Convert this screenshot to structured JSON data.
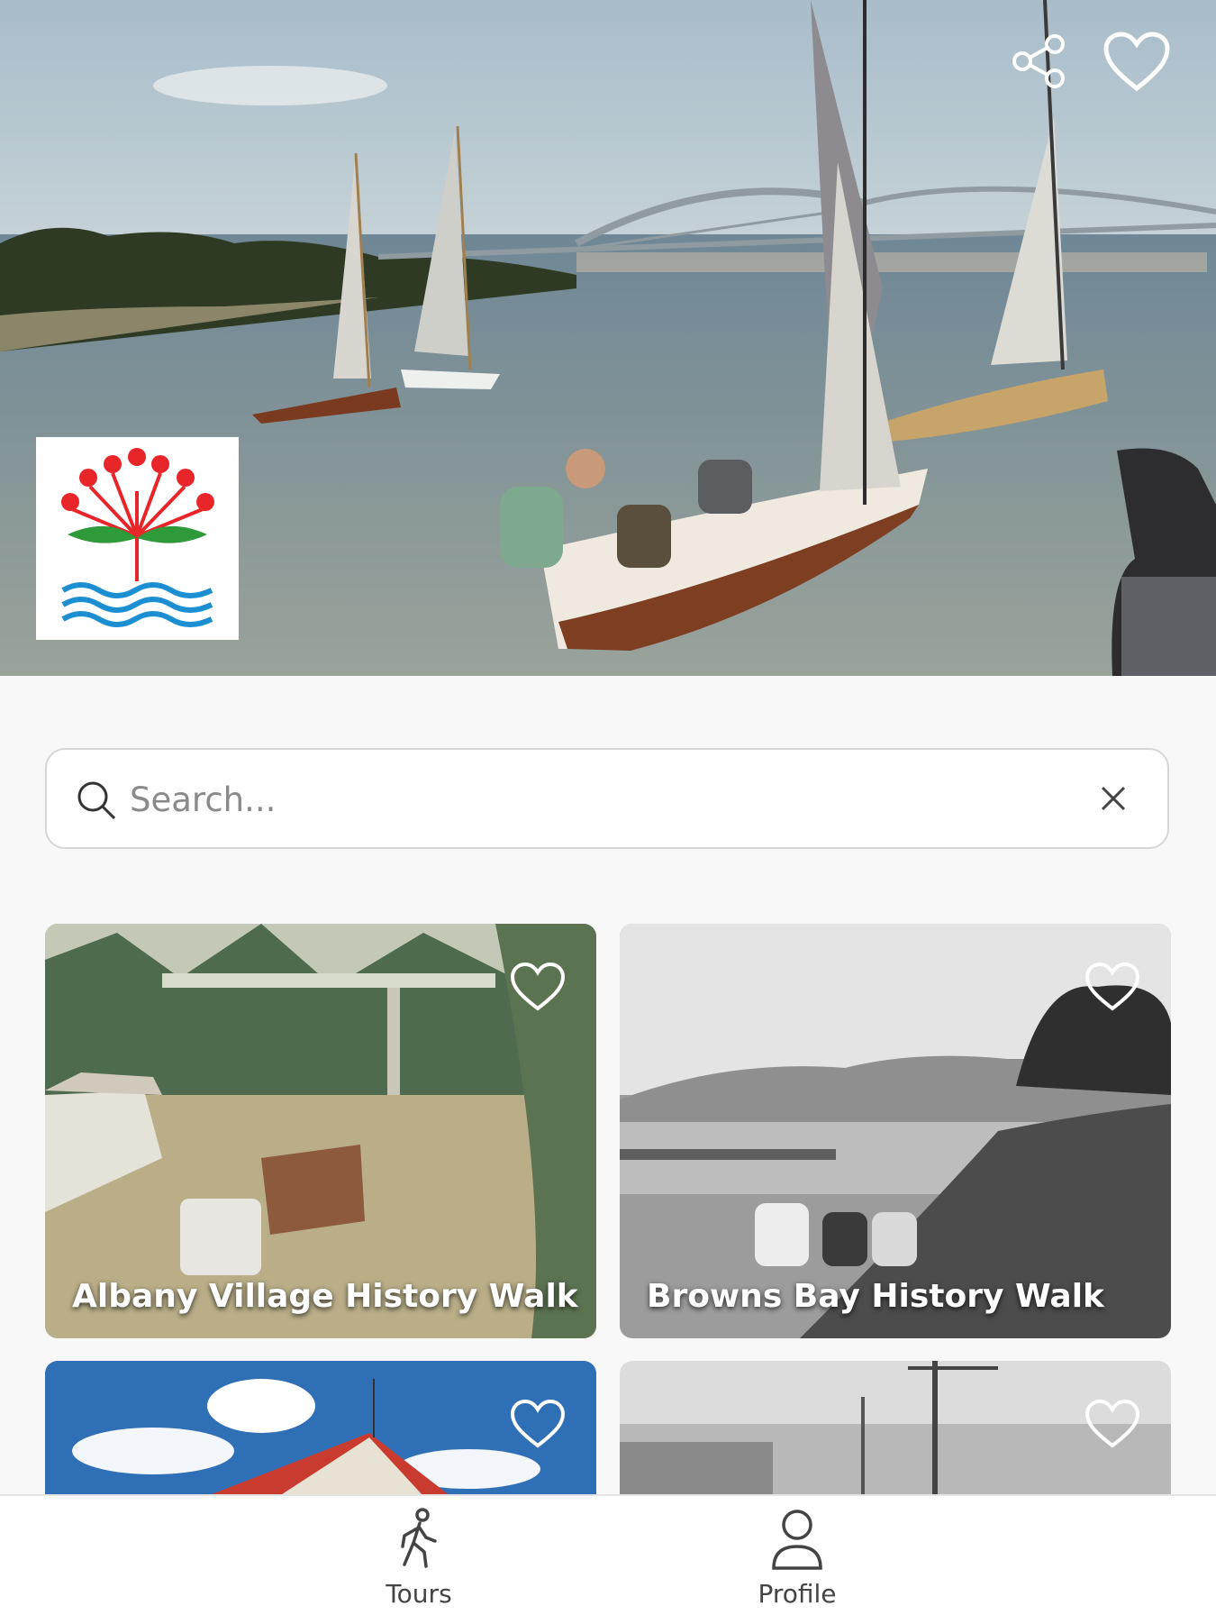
{
  "hero": {
    "share_icon": "share-icon",
    "favorite_icon": "heart-outline-icon",
    "logo": "pohutukawa-and-waves-logo"
  },
  "search": {
    "placeholder": "Search...",
    "value": "",
    "search_icon": "search-icon",
    "clear_icon": "close-icon"
  },
  "tours": [
    {
      "title": "Albany Village History Walk",
      "favorite_icon": "heart-outline-icon"
    },
    {
      "title": "Browns Bay History Walk",
      "favorite_icon": "heart-outline-icon"
    },
    {
      "title": "",
      "favorite_icon": "heart-outline-icon"
    },
    {
      "title": "",
      "favorite_icon": "heart-outline-icon"
    }
  ],
  "bottom_nav": {
    "tours": {
      "label": "Tours",
      "icon": "walking-person-icon"
    },
    "profile": {
      "label": "Profile",
      "icon": "user-icon"
    }
  },
  "colors": {
    "logo_red": "#e8262a",
    "logo_green": "#2e9a3a",
    "logo_blue": "#1b8fd2",
    "text_muted": "#444444"
  }
}
